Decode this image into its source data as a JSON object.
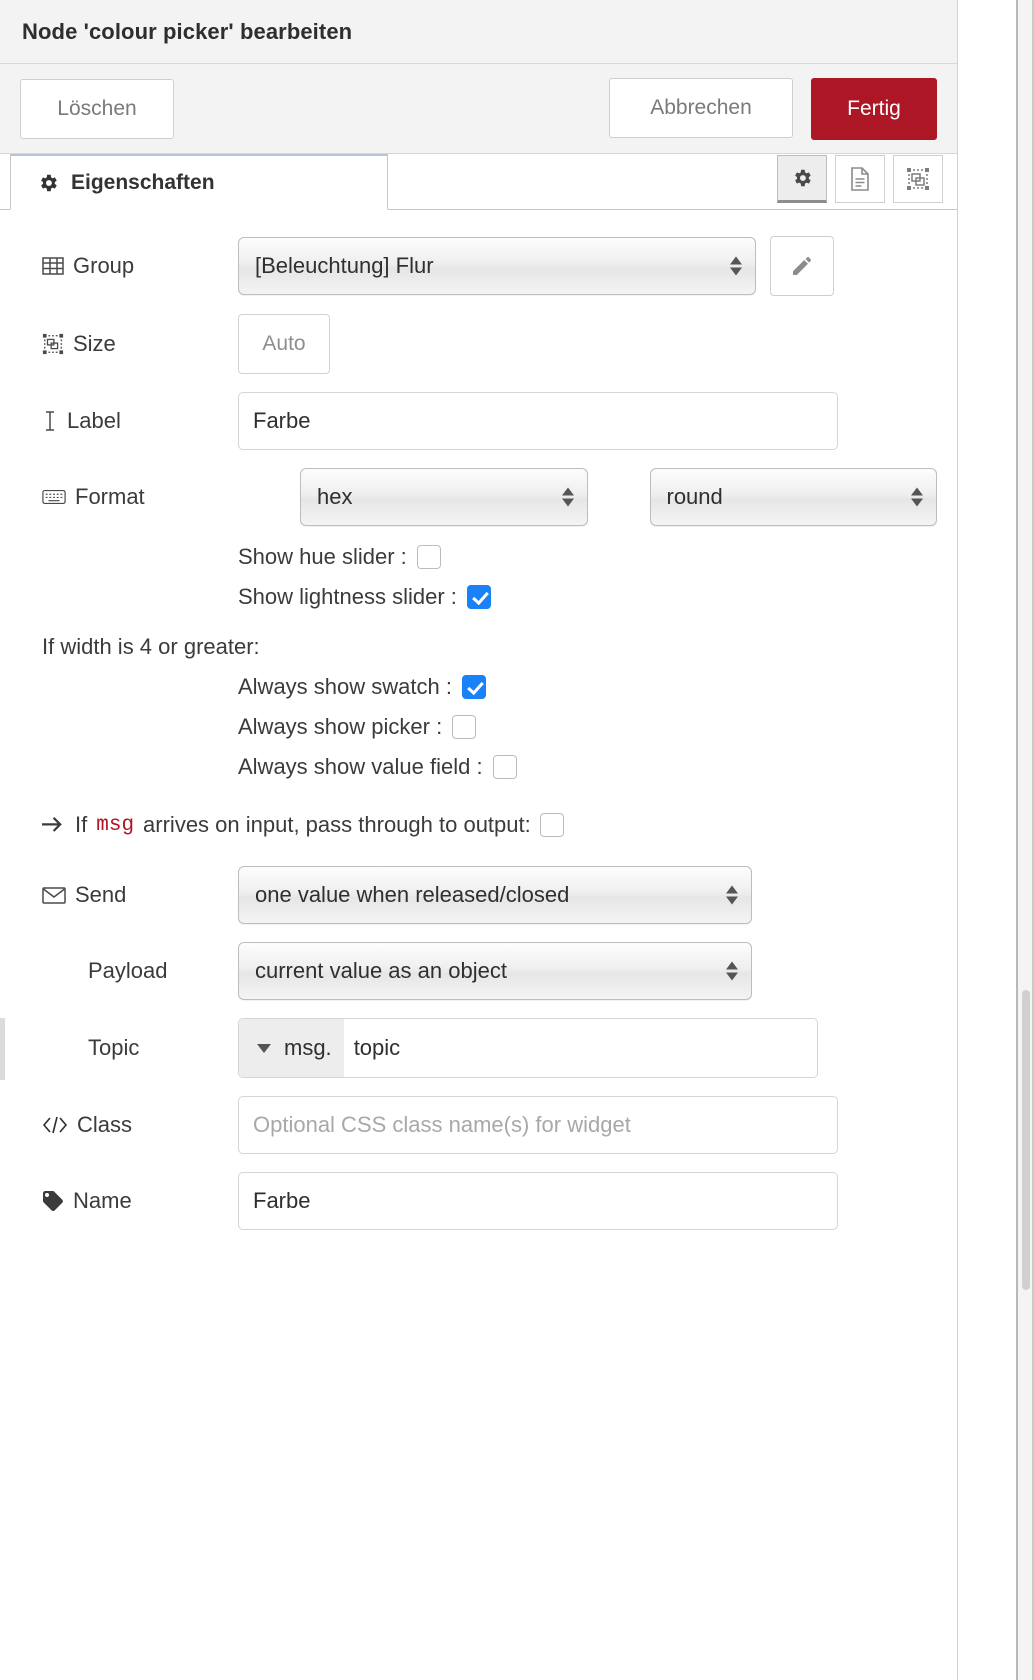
{
  "header": {
    "title": "Node 'colour picker' bearbeiten"
  },
  "actions": {
    "delete_label": "Löschen",
    "cancel_label": "Abbrechen",
    "done_label": "Fertig",
    "done_color": "#ad1625"
  },
  "tabs": {
    "properties_label": "Eigenschaften",
    "icon_buttons": [
      {
        "name": "gear-icon",
        "active": true
      },
      {
        "name": "description-icon",
        "active": false
      },
      {
        "name": "appearance-icon",
        "active": false
      }
    ]
  },
  "form": {
    "group": {
      "label": "Group",
      "value": "[Beleuchtung] Flur",
      "edit_button_icon": "pencil-icon"
    },
    "size": {
      "label": "Size",
      "value": "Auto"
    },
    "label_field": {
      "label": "Label",
      "value": "Farbe"
    },
    "format": {
      "label": "Format",
      "value": "hex",
      "shape_value": "round"
    },
    "toggles": [
      {
        "label": "Show hue slider :",
        "checked": false
      },
      {
        "label": "Show lightness slider :",
        "checked": true
      }
    ],
    "width_note": "If width is 4 or greater:",
    "width_toggles": [
      {
        "label": "Always show swatch :",
        "checked": true
      },
      {
        "label": "Always show picker :",
        "checked": false
      },
      {
        "label": "Always show value field :",
        "checked": false
      }
    ],
    "passthrough": {
      "text_before": "If",
      "code": "msg",
      "text_after": "arrives on input, pass through to output:",
      "checked": false
    },
    "send": {
      "label": "Send",
      "value": "one value when released/closed"
    },
    "payload": {
      "label": "Payload",
      "value": "current value as an object"
    },
    "topic": {
      "label": "Topic",
      "prefix": "msg.",
      "value": "topic"
    },
    "class_field": {
      "label": "Class",
      "value": "",
      "placeholder": "Optional CSS class name(s) for widget"
    },
    "name_field": {
      "label": "Name",
      "value": "Farbe"
    }
  }
}
